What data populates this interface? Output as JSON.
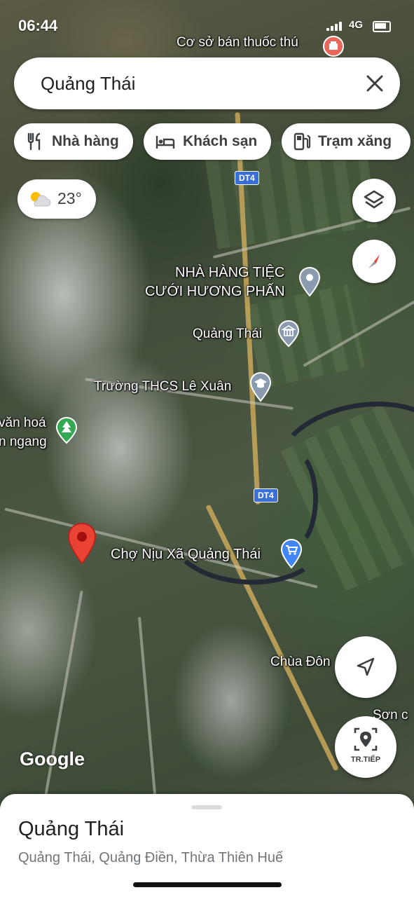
{
  "status_bar": {
    "time": "06:44",
    "network": "4G"
  },
  "search": {
    "query": "Quảng Thái"
  },
  "chips": [
    {
      "label": "Nhà hàng",
      "icon": "restaurant-icon"
    },
    {
      "label": "Khách sạn",
      "icon": "hotel-icon"
    },
    {
      "label": "Trạm xăng",
      "icon": "gas-station-icon"
    }
  ],
  "weather": {
    "temperature": "23°",
    "icon": "partly-cloudy-icon"
  },
  "map": {
    "labels": {
      "shop": "Cơ sở bán thuốc thú",
      "restaurant_line1": "NHÀ HÀNG TIỆC",
      "restaurant_line2": "CƯỚI HƯƠNG PHẤN",
      "admin": "Quảng Thái",
      "school": "Trường THCS Lê Xuân",
      "park_line1": "văn hoá",
      "park_line2": "n ngang",
      "market": "Chợ Nịu Xã Quảng Thái",
      "temple": "Chùa Đôn",
      "edge": "Sơn c"
    },
    "route_shields": [
      "DT4",
      "DT4"
    ],
    "attribution": "Google"
  },
  "buttons": {
    "start_label": "TR.TIẾP"
  },
  "place_sheet": {
    "title": "Quảng Thái",
    "subtitle": "Quảng Thái, Quảng Điền, Thừa Thiên Huế"
  },
  "colors": {
    "pin_red": "#ea4335",
    "shield_blue": "#3a6fd8",
    "accent_blue": "#4285f4"
  }
}
